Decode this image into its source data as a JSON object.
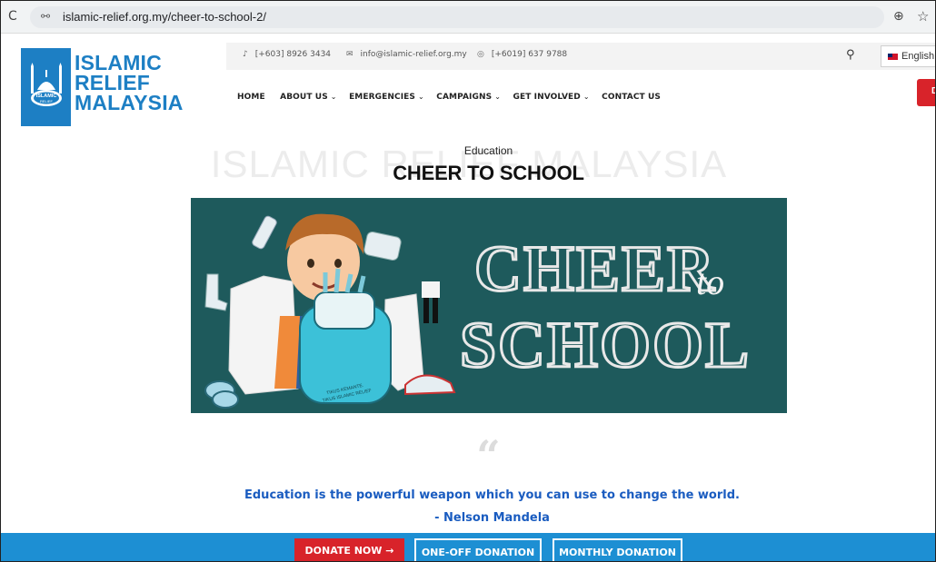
{
  "browser": {
    "url": "islamic-relief.org.my/cheer-to-school-2/",
    "reload_glyph": "C",
    "site_info_glyph": "⚯",
    "zoom_glyph": "⊕",
    "star_glyph": "☆"
  },
  "header": {
    "logo": {
      "line1": "ISLAMIC",
      "line2": "RELIEF",
      "line3": "MALAYSIA",
      "badge_text1": "ISLAMIC",
      "badge_text2": "RELIEF",
      "brand_color": "#1d7fc4"
    },
    "contact": {
      "phone_icon": "♪",
      "phone": "[+603] 8926 3434",
      "email_icon": "✉",
      "email": "info@islamic-relief.org.my",
      "whatsapp_icon": "◎",
      "whatsapp": "[+6019] 637 9788"
    },
    "search_icon": "⚲",
    "language": "English",
    "nav": [
      {
        "label": "HOME",
        "chevron": ""
      },
      {
        "label": "ABOUT US",
        "chevron": "⌄"
      },
      {
        "label": "EMERGENCIES",
        "chevron": "⌄"
      },
      {
        "label": "CAMPAIGNS",
        "chevron": "⌄"
      },
      {
        "label": "GET INVOLVED",
        "chevron": "⌄"
      },
      {
        "label": "CONTACT US",
        "chevron": ""
      }
    ],
    "cta_partial": "D",
    "cta_color": "#d8232a"
  },
  "page": {
    "watermark": "ISLAMIC RELIEF MALAYSIA",
    "category": "Education",
    "title": "CHEER TO SCHOOL",
    "banner": {
      "word1": "CHEER",
      "word2": "to",
      "word3": "SCHOOL",
      "bag_text1": "TIKUS KEMANTE.",
      "bag_text2": "TIKUS ISLAMIC RELIEF",
      "bg_color": "#1e5a5c"
    },
    "quote_mark": "“",
    "quote": "Education is the powerful weapon which you can use to change the world.",
    "author": "- Nelson Mandela"
  },
  "donate_bar": {
    "donate_now": "DONATE NOW  →",
    "one_off": "ONE-OFF DONATION",
    "monthly": "MONTHLY DONATION",
    "bar_color": "#1d8fd3"
  }
}
